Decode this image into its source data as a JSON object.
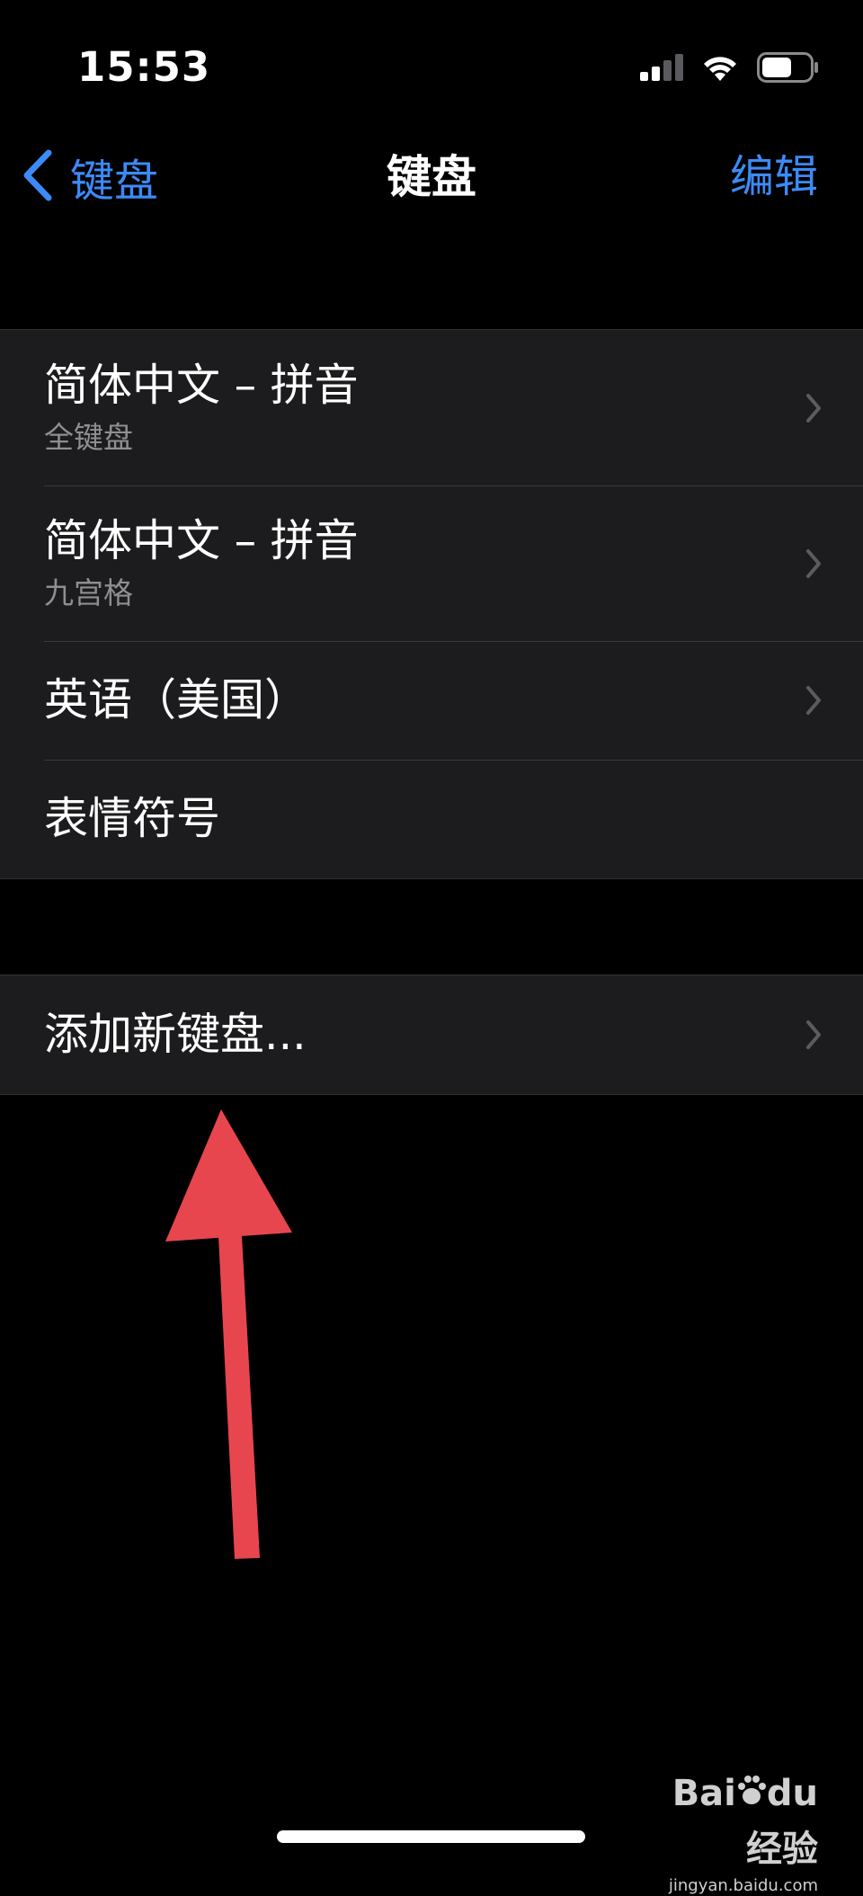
{
  "status_bar": {
    "time": "15:53",
    "icons": [
      "cellular-signal-icon",
      "wifi-icon",
      "battery-icon"
    ]
  },
  "nav": {
    "back_label": "键盘",
    "title": "键盘",
    "edit_label": "编辑"
  },
  "keyboards": [
    {
      "title": "简体中文 – 拼音",
      "subtitle": "全键盘",
      "has_chevron": true
    },
    {
      "title": "简体中文 – 拼音",
      "subtitle": "九宫格",
      "has_chevron": true
    },
    {
      "title": "英语（美国）",
      "has_chevron": true
    },
    {
      "title": "表情符号",
      "has_chevron": false
    }
  ],
  "add_keyboard": {
    "label": "添加新键盘..."
  },
  "annotation": {
    "arrow_color": "#e8464e"
  },
  "watermark": {
    "logo_left": "Bai",
    "logo_mid": "du",
    "logo_right": "经验",
    "url": "jingyan.baidu.com"
  },
  "colors": {
    "accent": "#3d8af7",
    "background": "#000000",
    "cell_background": "#1c1c1e",
    "secondary_text": "#8e8e93"
  }
}
